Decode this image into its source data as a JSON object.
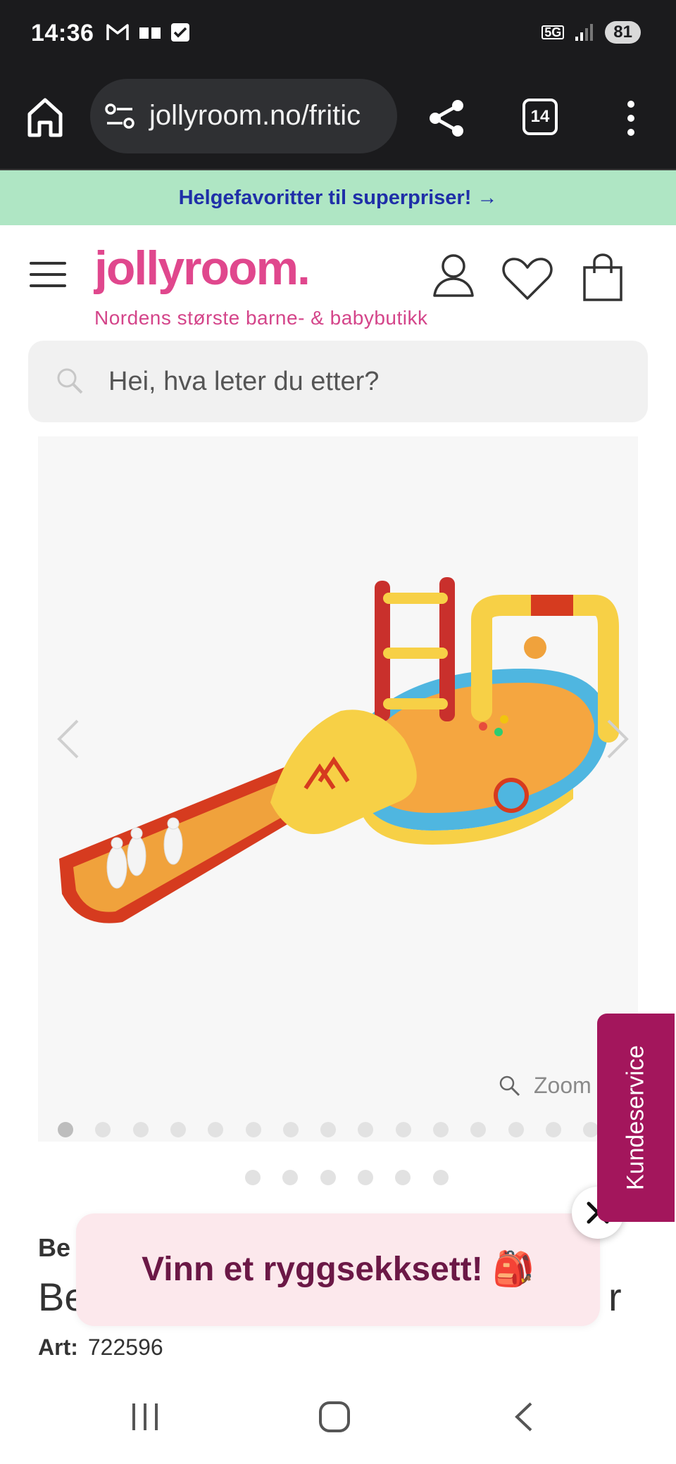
{
  "status_bar": {
    "time": "14:36",
    "network": "5G",
    "battery": "81"
  },
  "browser": {
    "url": "jollyroom.no/fritic",
    "tab_count": "14"
  },
  "promo": {
    "text": "Helgefavoritter til superpriser! →"
  },
  "header": {
    "logo": "jollyroom.",
    "tagline": "Nordens største barne- & babybutikk"
  },
  "search": {
    "placeholder": "Hei, hva leter du etter?"
  },
  "gallery": {
    "zoom_label": "Zoom",
    "image_count": 16,
    "active_index": 0
  },
  "product": {
    "brand": "Be",
    "title": "Be",
    "title_suffix": "r",
    "art_label": "Art:",
    "art_number": "722596"
  },
  "popup": {
    "text": "Vinn et ryggsekksett! 🎒"
  },
  "side_tab": {
    "label": "Kundeservice"
  },
  "colors": {
    "brand_pink": "#e0478d",
    "promo_bg": "#afe6c4",
    "promo_text": "#1f2fa8",
    "kundeservice_bg": "#a3165c",
    "popup_bg": "#fce8ec"
  }
}
